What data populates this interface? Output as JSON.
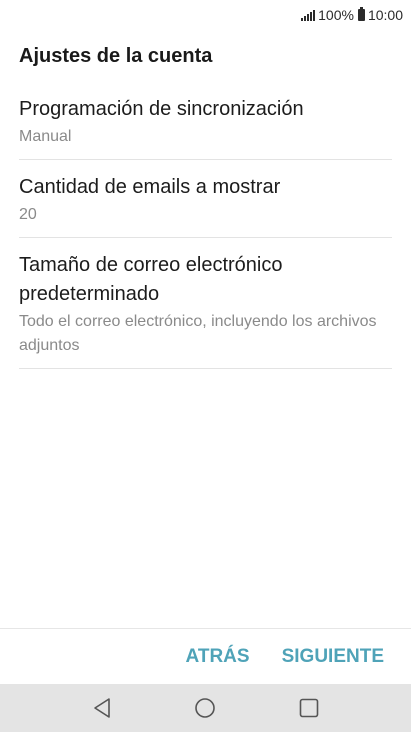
{
  "status_bar": {
    "battery": "100%",
    "time": "10:00"
  },
  "header": {
    "title": "Ajustes de la cuenta"
  },
  "settings": [
    {
      "label": "Programación de sincronización",
      "value": "Manual"
    },
    {
      "label": "Cantidad de emails a mostrar",
      "value": "20"
    },
    {
      "label": "Tamaño de correo electrónico predeterminado",
      "value": "Todo el correo electrónico, incluyendo los archivos adjuntos"
    }
  ],
  "actions": {
    "back_label": "ATRÁS",
    "next_label": "SIGUIENTE"
  },
  "colors": {
    "accent": "#4fa3b8",
    "nav_bar_bg": "#e4e4e4",
    "secondary_text": "#8a8a8a"
  },
  "icons": {
    "nav_back": "triangle-back-icon",
    "nav_home": "circle-home-icon",
    "nav_recents": "square-recents-icon"
  }
}
